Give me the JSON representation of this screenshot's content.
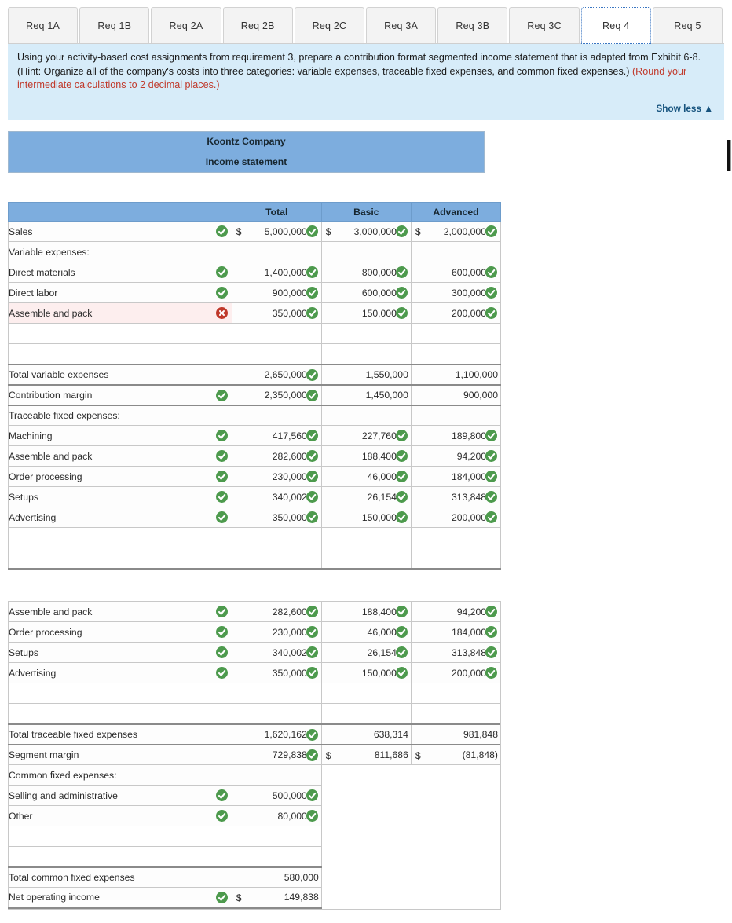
{
  "tabs": [
    {
      "label": "Req 1A",
      "active": false
    },
    {
      "label": "Req 1B",
      "active": false
    },
    {
      "label": "Req 2A",
      "active": false
    },
    {
      "label": "Req 2B",
      "active": false
    },
    {
      "label": "Req 2C",
      "active": false
    },
    {
      "label": "Req 3A",
      "active": false
    },
    {
      "label": "Req 3B",
      "active": false
    },
    {
      "label": "Req 3C",
      "active": false
    },
    {
      "label": "Req 4",
      "active": true
    },
    {
      "label": "Req 5",
      "active": false
    }
  ],
  "prompt": {
    "body": "Using your activity-based cost assignments from requirement 3, prepare a contribution format segmented income statement that is adapted from Exhibit 6-8. (Hint: Organize all of the company's costs into three categories: variable expenses, traceable fixed expenses, and common fixed expenses.) ",
    "hint": "(Round your intermediate calculations to 2 decimal places.)",
    "show_less": "Show less ▲"
  },
  "statement_title": {
    "company": "Koontz Company",
    "subtitle": "Income statement"
  },
  "colors": {
    "header_blue": "#7dadde",
    "panel_blue": "#d7ecf9",
    "correct_green": "#4d9a4d",
    "error_red": "#c0392b",
    "hint_red": "#c0392b",
    "link_blue": "#16537e"
  },
  "table_top": {
    "columns": [
      "",
      "Total",
      "Basic",
      "Advanced"
    ],
    "rows": [
      {
        "label": "Sales",
        "label_status": "correct",
        "cells": [
          {
            "dollar": "$",
            "value": "5,000,000",
            "status": "correct"
          },
          {
            "dollar": "$",
            "value": "3,000,000",
            "status": "correct"
          },
          {
            "dollar": "$",
            "value": "2,000,000",
            "status": "correct"
          }
        ]
      },
      {
        "label": "Variable expenses:",
        "label_status": "none",
        "cells": [
          {
            "value": "",
            "status": "none"
          },
          {
            "value": "",
            "status": "none"
          },
          {
            "value": "",
            "status": "none"
          }
        ]
      },
      {
        "label": "Direct materials",
        "label_status": "correct",
        "cells": [
          {
            "value": "1,400,000",
            "status": "correct"
          },
          {
            "value": "800,000",
            "status": "correct"
          },
          {
            "value": "600,000",
            "status": "correct"
          }
        ]
      },
      {
        "label": "Direct labor",
        "label_status": "correct",
        "cells": [
          {
            "value": "900,000",
            "status": "correct"
          },
          {
            "value": "600,000",
            "status": "correct"
          },
          {
            "value": "300,000",
            "status": "correct"
          }
        ]
      },
      {
        "label": "Assemble and pack",
        "label_status": "error",
        "cells": [
          {
            "value": "350,000",
            "status": "correct"
          },
          {
            "value": "150,000",
            "status": "correct"
          },
          {
            "value": "200,000",
            "status": "correct"
          }
        ]
      },
      {
        "label": "",
        "label_status": "none",
        "blank": true,
        "cells": [
          {
            "value": "",
            "status": "none"
          },
          {
            "value": "",
            "status": "none"
          },
          {
            "value": "",
            "status": "none"
          }
        ]
      },
      {
        "label": "",
        "label_status": "none",
        "blank": true,
        "cells": [
          {
            "value": "",
            "status": "none"
          },
          {
            "value": "",
            "status": "none"
          },
          {
            "value": "",
            "status": "none"
          }
        ]
      },
      {
        "label": "Total variable expenses",
        "label_status": "none",
        "rule": "top",
        "cells": [
          {
            "value": "2,650,000",
            "status": "correct"
          },
          {
            "value": "1,550,000",
            "status": "none"
          },
          {
            "value": "1,100,000",
            "status": "none"
          }
        ]
      },
      {
        "label": "Contribution margin",
        "label_status": "correct",
        "rule": "top",
        "cells": [
          {
            "value": "2,350,000",
            "status": "correct"
          },
          {
            "value": "1,450,000",
            "status": "none"
          },
          {
            "value": "900,000",
            "status": "none"
          }
        ]
      },
      {
        "label": "Traceable fixed expenses:",
        "label_status": "none",
        "rule": "top",
        "cells": [
          {
            "value": "",
            "status": "none"
          },
          {
            "value": "",
            "status": "none"
          },
          {
            "value": "",
            "status": "none"
          }
        ]
      },
      {
        "label": "Machining",
        "label_status": "correct",
        "cells": [
          {
            "value": "417,560",
            "status": "correct"
          },
          {
            "value": "227,760",
            "status": "correct"
          },
          {
            "value": "189,800",
            "status": "correct"
          }
        ]
      },
      {
        "label": "Assemble and pack",
        "label_status": "correct",
        "cells": [
          {
            "value": "282,600",
            "status": "correct"
          },
          {
            "value": "188,400",
            "status": "correct"
          },
          {
            "value": "94,200",
            "status": "correct"
          }
        ]
      },
      {
        "label": "Order processing",
        "label_status": "correct",
        "cells": [
          {
            "value": "230,000",
            "status": "correct"
          },
          {
            "value": "46,000",
            "status": "correct"
          },
          {
            "value": "184,000",
            "status": "correct"
          }
        ]
      },
      {
        "label": "Setups",
        "label_status": "correct",
        "cells": [
          {
            "value": "340,002",
            "status": "correct"
          },
          {
            "value": "26,154",
            "status": "correct"
          },
          {
            "value": "313,848",
            "status": "correct"
          }
        ]
      },
      {
        "label": "Advertising",
        "label_status": "correct",
        "cells": [
          {
            "value": "350,000",
            "status": "correct"
          },
          {
            "value": "150,000",
            "status": "correct"
          },
          {
            "value": "200,000",
            "status": "correct"
          }
        ]
      },
      {
        "label": "",
        "label_status": "none",
        "blank": true,
        "cells": [
          {
            "value": "",
            "status": "none"
          },
          {
            "value": "",
            "status": "none"
          },
          {
            "value": "",
            "status": "none"
          }
        ]
      },
      {
        "label": "",
        "label_status": "none",
        "blank": true,
        "rule": "bottom",
        "cells": [
          {
            "value": "",
            "status": "none"
          },
          {
            "value": "",
            "status": "none"
          },
          {
            "value": "",
            "status": "none"
          }
        ]
      }
    ]
  },
  "table_bottom": {
    "rows": [
      {
        "label": "Assemble and pack",
        "label_status": "correct",
        "cells": [
          {
            "value": "282,600",
            "status": "correct"
          },
          {
            "value": "188,400",
            "status": "correct"
          },
          {
            "value": "94,200",
            "status": "correct"
          }
        ]
      },
      {
        "label": "Order processing",
        "label_status": "correct",
        "cells": [
          {
            "value": "230,000",
            "status": "correct"
          },
          {
            "value": "46,000",
            "status": "correct"
          },
          {
            "value": "184,000",
            "status": "correct"
          }
        ]
      },
      {
        "label": "Setups",
        "label_status": "correct",
        "cells": [
          {
            "value": "340,002",
            "status": "correct"
          },
          {
            "value": "26,154",
            "status": "correct"
          },
          {
            "value": "313,848",
            "status": "correct"
          }
        ]
      },
      {
        "label": "Advertising",
        "label_status": "correct",
        "cells": [
          {
            "value": "350,000",
            "status": "correct"
          },
          {
            "value": "150,000",
            "status": "correct"
          },
          {
            "value": "200,000",
            "status": "correct"
          }
        ]
      },
      {
        "label": "",
        "label_status": "none",
        "blank": true,
        "cells": [
          {
            "value": "",
            "status": "none"
          },
          {
            "value": "",
            "status": "none"
          },
          {
            "value": "",
            "status": "none"
          }
        ]
      },
      {
        "label": "",
        "label_status": "none",
        "blank": true,
        "cells": [
          {
            "value": "",
            "status": "none"
          },
          {
            "value": "",
            "status": "none"
          },
          {
            "value": "",
            "status": "none"
          }
        ]
      },
      {
        "label": "Total traceable fixed expenses",
        "label_status": "none",
        "rule": "top",
        "cells": [
          {
            "value": "1,620,162",
            "status": "correct"
          },
          {
            "value": "638,314",
            "status": "none"
          },
          {
            "value": "981,848",
            "status": "none"
          }
        ]
      },
      {
        "label": "Segment margin",
        "label_status": "none",
        "rule": "top",
        "cells": [
          {
            "value": "729,838",
            "status": "correct"
          },
          {
            "dollar": "$",
            "value": "811,686",
            "status": "none"
          },
          {
            "dollar": "$",
            "value": "(81,848)",
            "status": "none"
          }
        ]
      },
      {
        "label": "Common fixed expenses:",
        "label_status": "none",
        "rule": "bottom23",
        "cells": [
          {
            "value": "",
            "status": "none"
          },
          {
            "value": "",
            "status": "none",
            "empty_col": true
          },
          {
            "value": "",
            "status": "none",
            "empty_col": true
          }
        ]
      },
      {
        "label": "Selling and administrative",
        "label_status": "correct",
        "cells": [
          {
            "value": "500,000",
            "status": "correct"
          },
          {
            "value": "",
            "status": "none",
            "empty_col": true
          },
          {
            "value": "",
            "status": "none",
            "empty_col": true
          }
        ]
      },
      {
        "label": "Other",
        "label_status": "correct",
        "cells": [
          {
            "value": "80,000",
            "status": "correct"
          },
          {
            "value": "",
            "status": "none",
            "empty_col": true
          },
          {
            "value": "",
            "status": "none",
            "empty_col": true
          }
        ]
      },
      {
        "label": "",
        "label_status": "none",
        "blank": true,
        "cells": [
          {
            "value": "",
            "status": "none"
          },
          {
            "value": "",
            "status": "none",
            "empty_col": true
          },
          {
            "value": "",
            "status": "none",
            "empty_col": true
          }
        ]
      },
      {
        "label": "",
        "label_status": "none",
        "blank": true,
        "cells": [
          {
            "value": "",
            "status": "none"
          },
          {
            "value": "",
            "status": "none",
            "empty_col": true
          },
          {
            "value": "",
            "status": "none",
            "empty_col": true
          }
        ]
      },
      {
        "label": "Total common fixed expenses",
        "label_status": "none",
        "rule": "top",
        "cells": [
          {
            "value": "580,000",
            "status": "none"
          },
          {
            "value": "",
            "status": "none",
            "empty_col": true
          },
          {
            "value": "",
            "status": "none",
            "empty_col": true
          }
        ]
      },
      {
        "label": "Net operating income",
        "label_status": "correct",
        "rule": "bottom",
        "cells": [
          {
            "dollar": "$",
            "value": "149,838",
            "status": "none"
          },
          {
            "value": "",
            "status": "none",
            "empty_col": true
          },
          {
            "value": "",
            "status": "none",
            "empty_col": true
          }
        ]
      }
    ]
  }
}
